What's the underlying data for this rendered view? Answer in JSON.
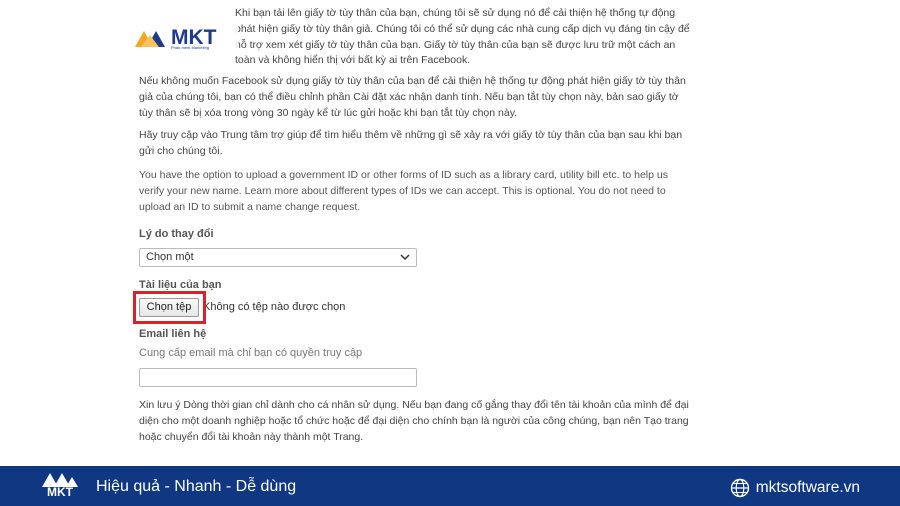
{
  "form": {
    "intro_partial": "Khi bạn tải lên giấy tờ tùy thân của bạn, chúng tôi sẽ sử dụng nó để cải thiện hệ thống tự động phát hiện giấy tờ tùy thân giả. Chúng tôi có thể sử dụng các nhà cung cấp dịch vụ đáng tin cậy để hỗ trợ xem xét giấy tờ tùy thân của bạn. Giấy tờ tùy thân của bạn sẽ được lưu trữ một cách an toàn và không hiển thị với bất kỳ ai trên Facebook.",
    "para_1": "Nếu không muốn Facebook sử dụng giấy tờ tùy thân của bạn để cải thiện hệ thống tự động phát hiện giấy tờ tùy thân giả của chúng tôi, bạn có thể điều chỉnh phần Cài đặt xác nhận danh tính. Nếu bạn tắt tùy chọn này, bản sao giấy tờ tùy thân sẽ bị xóa trong vòng 30 ngày kể từ lúc gửi hoặc khi bạn tắt tùy chọn này.",
    "para_2": "Hãy truy cập vào Trung tâm trợ giúp để tìm hiểu thêm về những gì sẽ xảy ra với giấy tờ tùy thân của bạn sau khi bạn gửi cho chúng tôi.",
    "para_3": "You have the option to upload a government ID or other forms of ID such as a library card, utility bill etc. to help us verify your new name. Learn more about different types of IDs we can accept. This is optional. You do not need to upload an ID to submit a name change request.",
    "reason_label": "Lý do thay đổi",
    "reason_select_value": "Chọn một",
    "docs_label": "Tài liệu của bạn",
    "choose_file_button": "Chọn tệp",
    "file_status": "Không có tệp nào được chọn",
    "email_label": "Email liên hệ",
    "email_hint": "Cung cấp email mà chỉ bạn có quyền truy cập",
    "email_value": "",
    "para_4": "Xin lưu ý Dòng thời gian chỉ dành cho cá nhân sử dụng. Nếu bạn đang cố gắng thay đổi tên tài khoản của mình để đại diện cho một doanh nghiệp hoặc tổ chức hoặc để đại diện cho chính bạn là người của công chúng, bạn nên Tạo trang hoặc chuyển đổi tài khoản này thành một Trang."
  },
  "watermark": {
    "brand": "MKT",
    "tagline": "Phần mềm Marketing"
  },
  "footer": {
    "logo_text": "MKT",
    "slogan": "Hiệu quả - Nhanh - Dễ dùng",
    "website": "mktsoftware.vn"
  },
  "colors": {
    "footer_bg": "#0f3782",
    "highlight": "#d8232a",
    "logo_blue": "#1e3a8a",
    "logo_orange": "#f5a623"
  },
  "icons": [
    "chevron-down-icon",
    "globe-icon",
    "mkt-logo-icon"
  ]
}
